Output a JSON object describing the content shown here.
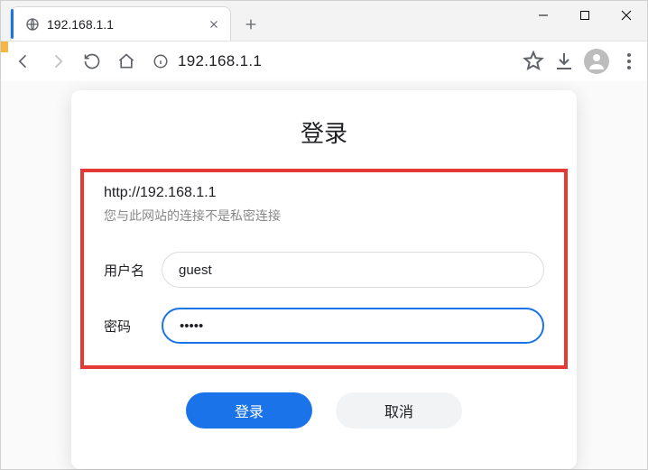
{
  "tab": {
    "title": "192.168.1.1"
  },
  "address": {
    "url": "192.168.1.1"
  },
  "dialog": {
    "title": "登录",
    "url_text": "http://192.168.1.1",
    "warning_text": "您与此网站的连接不是私密连接",
    "username_label": "用户名",
    "username_value": "guest",
    "password_label": "密码",
    "password_value": "•••••",
    "login_button": "登录",
    "cancel_button": "取消"
  }
}
